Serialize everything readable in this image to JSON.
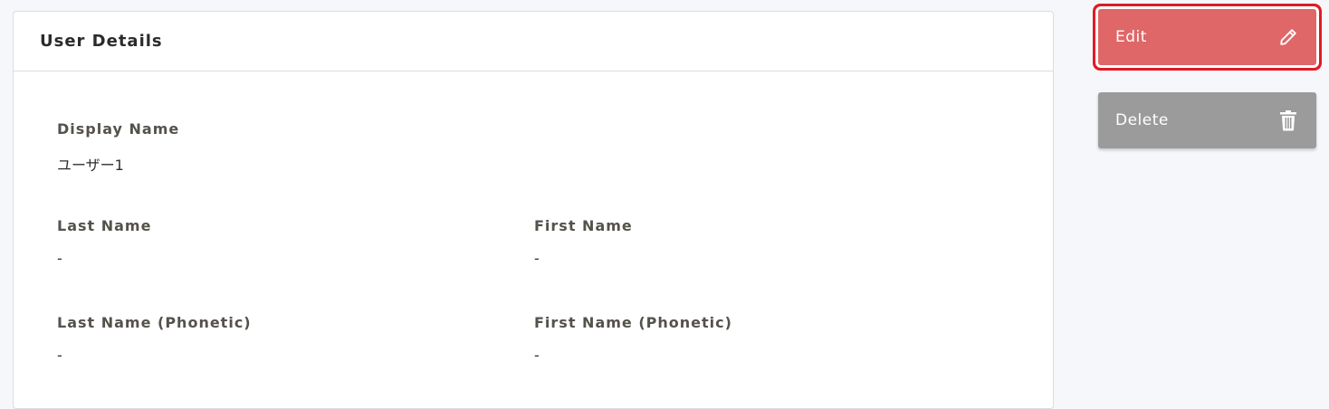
{
  "card": {
    "title": "User Details"
  },
  "fields": {
    "display_name": {
      "label": "Display Name",
      "value": "ユーザー1"
    },
    "last_name": {
      "label": "Last Name",
      "value": "-"
    },
    "first_name": {
      "label": "First Name",
      "value": "-"
    },
    "last_name_phonetic": {
      "label": "Last Name (Phonetic)",
      "value": "-"
    },
    "first_name_phonetic": {
      "label": "First Name (Phonetic)",
      "value": "-"
    }
  },
  "actions": {
    "edit_label": "Edit",
    "edit_icon": "pencil-icon",
    "delete_label": "Delete",
    "delete_icon": "trash-icon"
  },
  "colors": {
    "edit_button": "#df6767",
    "highlight_outline": "#e01b25",
    "delete_button": "#9b9b9b"
  }
}
